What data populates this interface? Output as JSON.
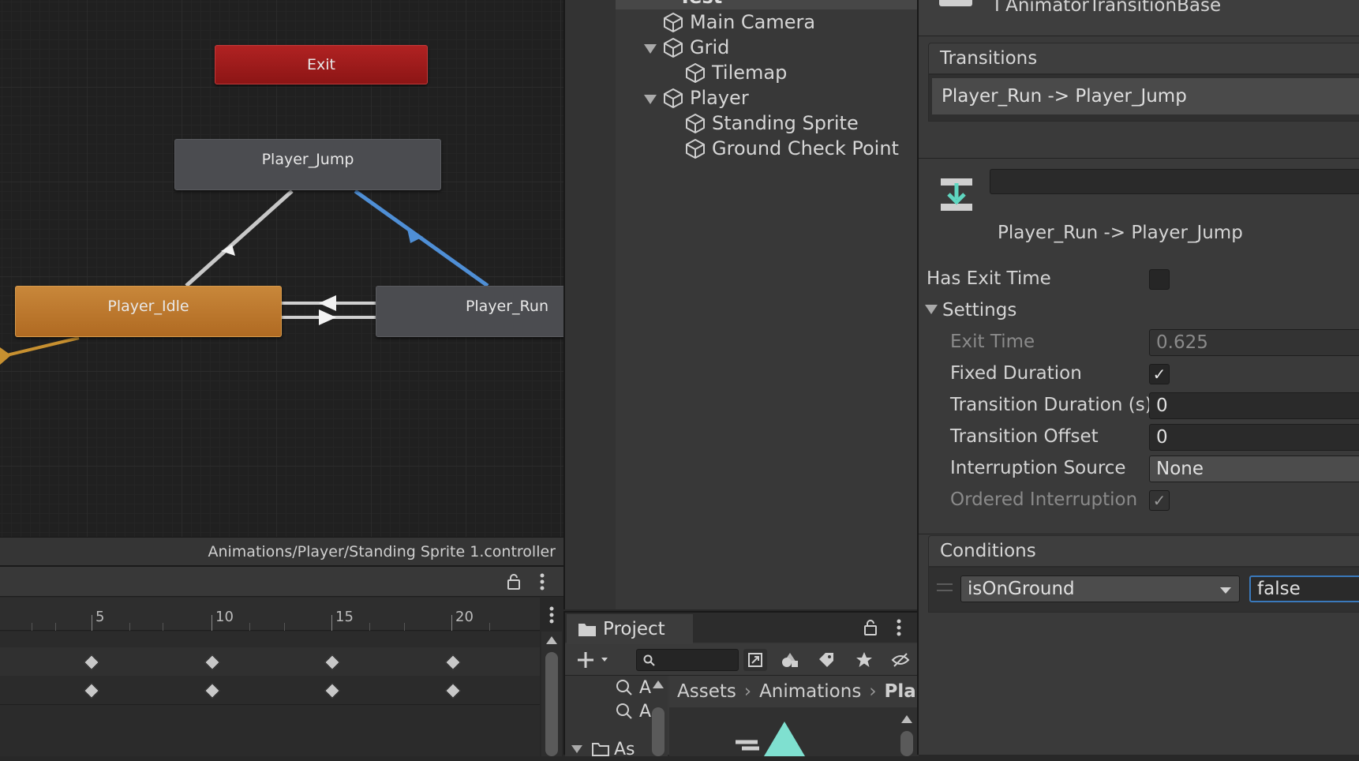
{
  "animator": {
    "nodes": {
      "exit": "Exit",
      "player_jump": "Player_Jump",
      "player_idle": "Player_Idle",
      "player_run": "Player_Run"
    },
    "controller_path": "Animations/Player/Standing Sprite 1.controller"
  },
  "timeline": {
    "ticks": [
      "5",
      "10",
      "15",
      "20"
    ]
  },
  "hierarchy": {
    "scene": "Test",
    "items": [
      {
        "label": "Main Camera"
      },
      {
        "label": "Grid"
      },
      {
        "label": "Tilemap"
      },
      {
        "label": "Player"
      },
      {
        "label": "Standing Sprite"
      },
      {
        "label": "Ground Check Point"
      }
    ]
  },
  "project": {
    "tab": "Project",
    "breadcrumb": [
      "Assets",
      "Animations",
      "Pla"
    ],
    "left_items": [
      "A",
      "A",
      "As"
    ]
  },
  "inspector": {
    "header_type": "AnimatorTransitionBase",
    "transitions_title": "Transitions",
    "transition_item": "Player_Run -> Player_Jump",
    "transition_name": "Player_Run -> Player_Jump",
    "has_exit_time_label": "Has Exit Time",
    "has_exit_time": false,
    "settings_label": "Settings",
    "exit_time_label": "Exit Time",
    "exit_time": "0.625",
    "fixed_duration_label": "Fixed Duration",
    "fixed_duration": true,
    "transition_duration_label": "Transition Duration (s)",
    "transition_duration": "0",
    "transition_offset_label": "Transition Offset",
    "transition_offset": "0",
    "interruption_source_label": "Interruption Source",
    "interruption_source": "None",
    "ordered_interruption_label": "Ordered Interruption",
    "ordered_interruption": true,
    "conditions_title": "Conditions",
    "condition_param": "isOnGround",
    "condition_value": "false"
  },
  "colors": {
    "exit_node": "#a01b1b",
    "idle_node": "#c07c30",
    "state_node": "#4b4c50",
    "transition_highlight": "#4f8fd6",
    "entry_transition": "#c79030"
  }
}
